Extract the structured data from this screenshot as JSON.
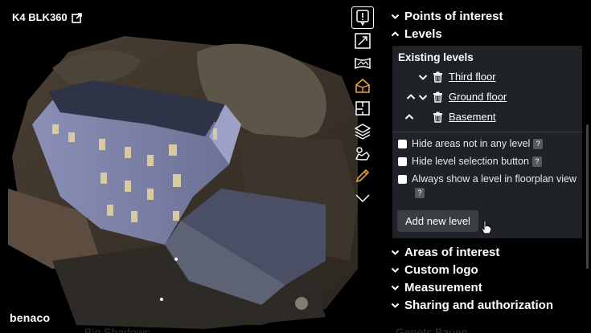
{
  "viewer": {
    "model_title": "K4 BLK360",
    "brand": "benaco",
    "share_icon": "external-share-icon",
    "toolbar": [
      {
        "name": "help-icon"
      },
      {
        "name": "fullscreen-icon"
      },
      {
        "name": "panorama-icon"
      },
      {
        "name": "house-3d-icon",
        "active": true
      },
      {
        "name": "floorplan-icon"
      },
      {
        "name": "layers-icon"
      },
      {
        "name": "walkthrough-icon"
      },
      {
        "name": "pencil-icon"
      },
      {
        "name": "chevron-down-icon"
      }
    ],
    "ghost_text_left": "Big Shadows",
    "ghost_text_right": "Genets Bauen"
  },
  "panel": {
    "sections_top": [
      {
        "label": "Points of interest",
        "expanded": false
      },
      {
        "label": "Levels",
        "expanded": true
      }
    ],
    "levels": {
      "heading": "Existing levels",
      "items": [
        {
          "label": "Third floor",
          "up": false,
          "down": true
        },
        {
          "label": "Ground floor",
          "up": true,
          "down": true
        },
        {
          "label": "Basement",
          "up": true,
          "down": false
        }
      ],
      "options": [
        {
          "label": "Hide areas not in any level",
          "help": "?"
        },
        {
          "label": "Hide level selection button",
          "help": "?"
        },
        {
          "label": "Always show a level in floorplan view",
          "help": "?"
        }
      ],
      "add_button": "Add new level"
    },
    "sections_bottom": [
      {
        "label": "Areas of interest"
      },
      {
        "label": "Custom logo"
      },
      {
        "label": "Measurement"
      },
      {
        "label": "Sharing and authorization"
      }
    ]
  },
  "colors": {
    "accent": "#e8a33a",
    "panel_box": "#1f2226",
    "button": "#3a3e44"
  }
}
